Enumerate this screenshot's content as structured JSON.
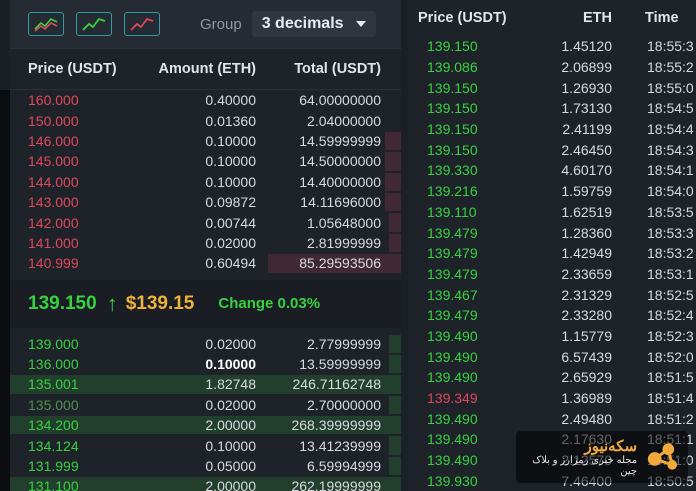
{
  "toolbar": {
    "group_label": "Group",
    "decimals": "3 decimals",
    "view_icons": [
      "both-sides-chart-icon",
      "bids-chart-icon",
      "asks-chart-icon"
    ]
  },
  "orderbook": {
    "headers": {
      "price": "Price (USDT)",
      "amount": "Amount (ETH)",
      "total": "Total (USDT)"
    },
    "asks": [
      {
        "price": "160.000",
        "amount": "0.40000",
        "total": "64.00000000",
        "depth": 0.0
      },
      {
        "price": "150.000",
        "amount": "0.01360",
        "total": "2.04000000",
        "depth": 0.0
      },
      {
        "price": "146.000",
        "amount": "0.10000",
        "total": "14.59999999",
        "depth": 0.04
      },
      {
        "price": "145.000",
        "amount": "0.10000",
        "total": "14.50000000",
        "depth": 0.04
      },
      {
        "price": "144.000",
        "amount": "0.10000",
        "total": "14.40000000",
        "depth": 0.04
      },
      {
        "price": "143.000",
        "amount": "0.09872",
        "total": "14.11696000",
        "depth": 0.04
      },
      {
        "price": "142.000",
        "amount": "0.00744",
        "total": "1.05648000",
        "depth": 0.03
      },
      {
        "price": "141.000",
        "amount": "0.02000",
        "total": "2.81999999",
        "depth": 0.03
      },
      {
        "price": "140.999",
        "amount": "0.60494",
        "total": "85.29593506",
        "depth": 0.34
      }
    ],
    "mid": {
      "price": "139.150",
      "usd": "$139.15",
      "change": "Change 0.03%"
    },
    "bids": [
      {
        "price": "139.000",
        "amount": "0.02000",
        "total": "2.77999999",
        "depth": 0.03
      },
      {
        "price": "136.000",
        "amount": "0.10000",
        "total": "13.59999999",
        "depth": 0.03,
        "highlight": true
      },
      {
        "price": "135.001",
        "amount": "1.82748",
        "total": "246.71162748",
        "depth": 1.0
      },
      {
        "price": "135.000",
        "amount": "0.02000",
        "total": "2.70000000",
        "depth": 0.03,
        "dim": true
      },
      {
        "price": "134.200",
        "amount": "2.00000",
        "total": "268.39999999",
        "depth": 1.0
      },
      {
        "price": "134.124",
        "amount": "0.10000",
        "total": "13.41239999",
        "depth": 0.03
      },
      {
        "price": "131.999",
        "amount": "0.05000",
        "total": "6.59994999",
        "depth": 0.03
      },
      {
        "price": "131.100",
        "amount": "2.00000",
        "total": "262.19999999",
        "depth": 1.0
      }
    ]
  },
  "trades": {
    "headers": {
      "price": "Price (USDT)",
      "eth": "ETH",
      "time": "Time"
    },
    "rows": [
      {
        "price": "139.150",
        "eth": "1.45120",
        "time": "18:55:3",
        "dir": "up"
      },
      {
        "price": "139.086",
        "eth": "2.06899",
        "time": "18:55:2",
        "dir": "up"
      },
      {
        "price": "139.150",
        "eth": "1.26930",
        "time": "18:55:0",
        "dir": "up"
      },
      {
        "price": "139.150",
        "eth": "1.73130",
        "time": "18:54:5",
        "dir": "up"
      },
      {
        "price": "139.150",
        "eth": "2.41199",
        "time": "18:54:4",
        "dir": "up"
      },
      {
        "price": "139.150",
        "eth": "2.46450",
        "time": "18:54:3",
        "dir": "up"
      },
      {
        "price": "139.330",
        "eth": "4.60170",
        "time": "18:54:1",
        "dir": "up"
      },
      {
        "price": "139.216",
        "eth": "1.59759",
        "time": "18:54:0",
        "dir": "up"
      },
      {
        "price": "139.110",
        "eth": "1.62519",
        "time": "18:53:5",
        "dir": "up"
      },
      {
        "price": "139.479",
        "eth": "1.28360",
        "time": "18:53:3",
        "dir": "up"
      },
      {
        "price": "139.479",
        "eth": "1.42949",
        "time": "18:53:2",
        "dir": "up"
      },
      {
        "price": "139.479",
        "eth": "2.33659",
        "time": "18:53:1",
        "dir": "up"
      },
      {
        "price": "139.467",
        "eth": "2.31329",
        "time": "18:52:5",
        "dir": "up"
      },
      {
        "price": "139.479",
        "eth": "2.33280",
        "time": "18:52:4",
        "dir": "up"
      },
      {
        "price": "139.490",
        "eth": "1.15779",
        "time": "18:52:3",
        "dir": "up"
      },
      {
        "price": "139.490",
        "eth": "6.57439",
        "time": "18:52:0",
        "dir": "up"
      },
      {
        "price": "139.490",
        "eth": "2.65929",
        "time": "18:51:5",
        "dir": "up"
      },
      {
        "price": "139.349",
        "eth": "1.36989",
        "time": "18:51:4",
        "dir": "down"
      },
      {
        "price": "139.490",
        "eth": "2.49480",
        "time": "18:51:2",
        "dir": "up"
      },
      {
        "price": "139.490",
        "eth": "2.17630",
        "time": "18:51:1",
        "dir": "up"
      },
      {
        "price": "139.490",
        "eth": "2.12570",
        "time": "18:51:0",
        "dir": "up"
      },
      {
        "price": "139.930",
        "eth": "7.46400",
        "time": "18:50:5",
        "dir": "up"
      }
    ]
  },
  "watermark": {
    "title": "سکه‌نیوز",
    "subtitle": "مجله خبری رمزارز و بلاک چین"
  },
  "colors": {
    "ask": "#e0475a",
    "bid": "#38d13f",
    "usd": "#f0b23a",
    "accent": "#2f9aa8"
  }
}
